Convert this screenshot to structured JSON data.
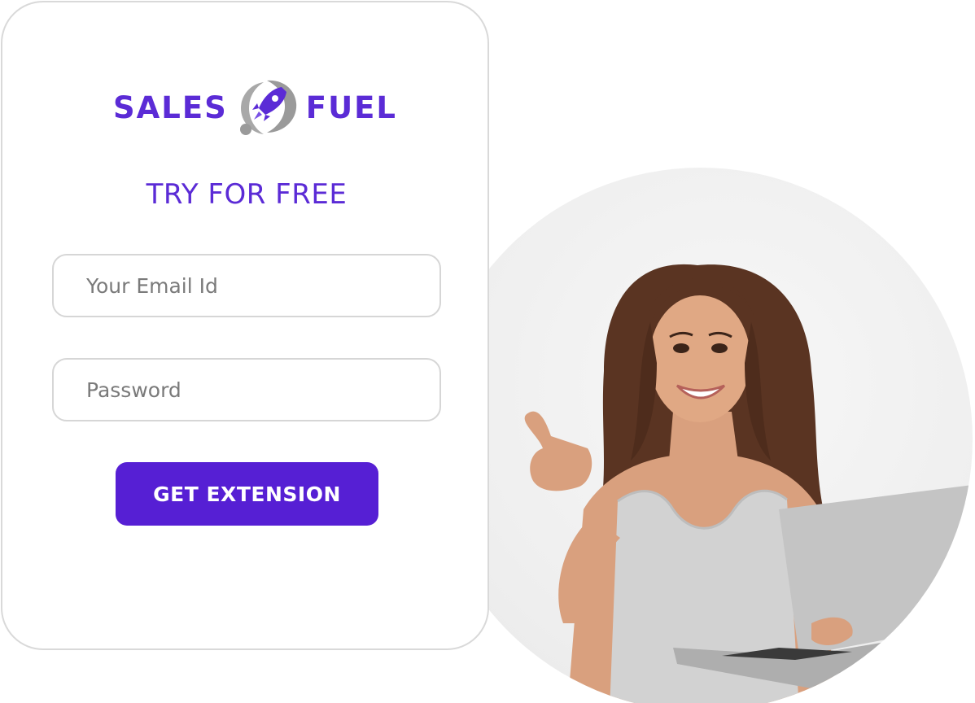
{
  "brand": {
    "word_left": "SALES",
    "word_right": "FUEL",
    "primary_color": "#5b2bd6",
    "emblem_icon": "rocket-icon"
  },
  "form": {
    "title": "TRY FOR FREE",
    "email_placeholder": "Your Email Id",
    "password_placeholder": "Password",
    "submit_label": "GET EXTENSION",
    "button_color": "#561fd4"
  },
  "hero_image": {
    "subject": "smiling-woman-with-laptop-pointing-thumb"
  }
}
